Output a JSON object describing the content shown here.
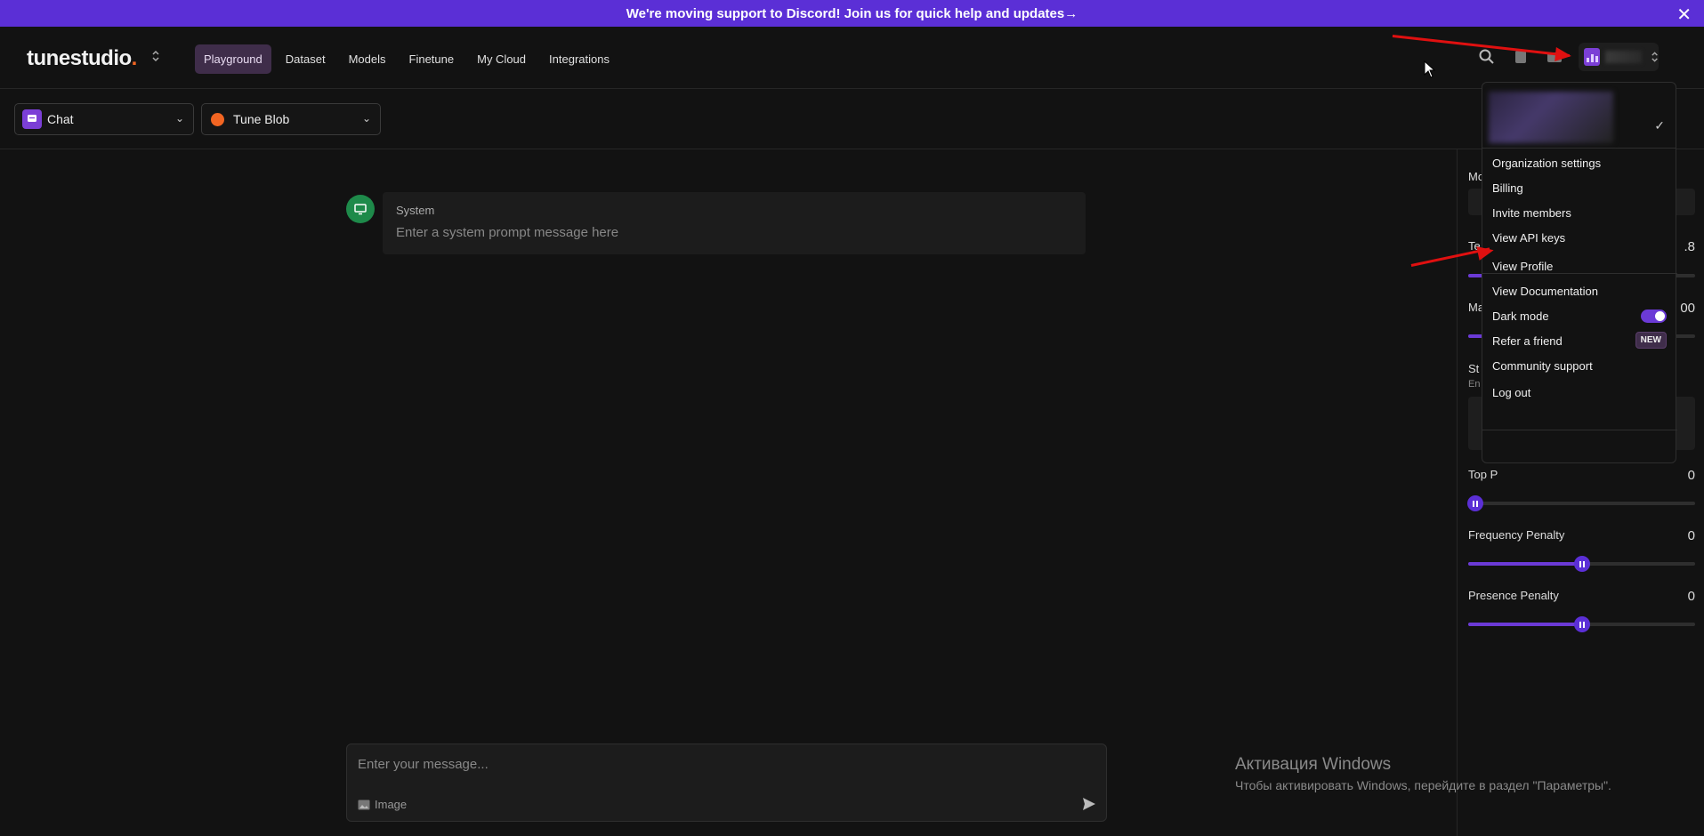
{
  "banner": {
    "text": "We're moving support to Discord! Join us for quick help and updates",
    "arrow": "→",
    "close": "✕"
  },
  "logo": {
    "main": "tunestudio",
    "dot": "."
  },
  "nav": {
    "tabs": [
      "Playground",
      "Dataset",
      "Models",
      "Finetune",
      "My Cloud",
      "Integrations"
    ],
    "active": "Playground"
  },
  "toolbar": {
    "mode": "Chat",
    "model": "Tune Blob"
  },
  "system": {
    "label": "System",
    "placeholder": "Enter a system prompt message here"
  },
  "composer": {
    "placeholder": "Enter your message...",
    "image_label": "Image"
  },
  "params": {
    "top_p": {
      "label": "Top P",
      "value": "0",
      "level": 0.03
    },
    "frequency_penalty": {
      "label": "Frequency Penalty",
      "value": "0",
      "level": 0.5
    },
    "presence_penalty": {
      "label": "Presence Penalty",
      "value": "0",
      "level": 0.5
    },
    "partial_labels": {
      "model": "Mo",
      "temperature": "Te",
      "temperature_value": ".8",
      "max": "Ma",
      "max_value": "00",
      "stop": "St",
      "stop_hint": "En"
    }
  },
  "menu": {
    "group1": [
      "Organization settings",
      "Billing",
      "Invite members",
      "View API keys"
    ],
    "group2": [
      "View Profile",
      "View Documentation",
      "Dark mode",
      "Refer a friend",
      "Community support"
    ],
    "group3": [
      "Log out"
    ],
    "badge": "NEW",
    "dark_mode_on": true
  },
  "watermark": {
    "title": "Активация Windows",
    "subtitle": "Чтобы активировать Windows, перейдите в раздел \"Параметры\"."
  },
  "colors": {
    "accent": "#5b2fd6",
    "banner": "#5b2fd6",
    "logo_dot": "#f26522",
    "system_avatar": "#1e8a4a",
    "annotation": "#e01010"
  },
  "icons": [
    "search-icon",
    "docs-icon",
    "folder-icon",
    "settings-icon",
    "chat-icon",
    "monitor-icon",
    "image-icon",
    "send-icon",
    "check-icon"
  ]
}
